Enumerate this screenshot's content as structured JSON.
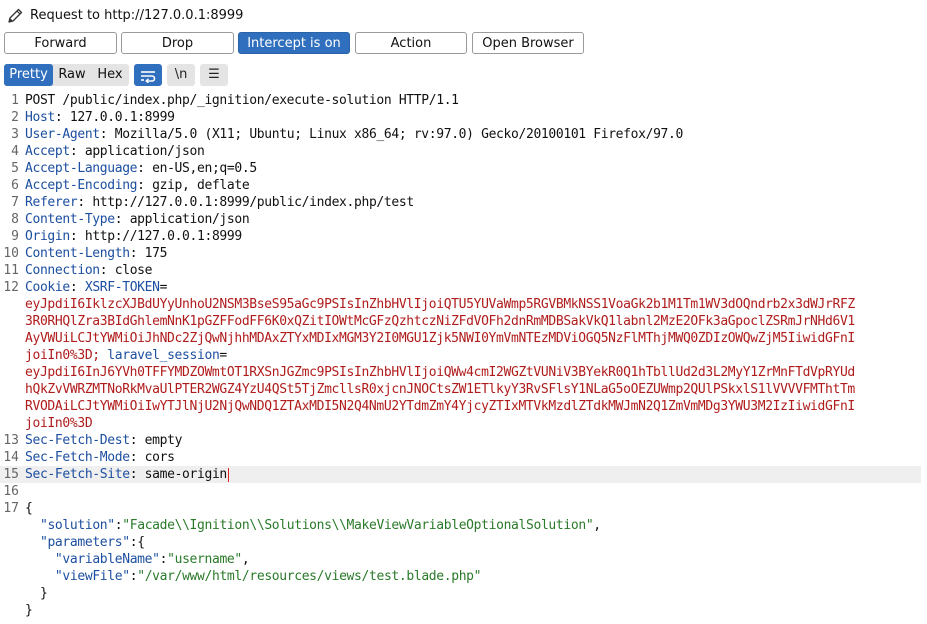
{
  "window": {
    "title": "Request to http://127.0.0.1:8999",
    "icon": "pencil-icon"
  },
  "actions": [
    {
      "id": "forward",
      "label": "Forward",
      "active": false
    },
    {
      "id": "drop",
      "label": "Drop",
      "active": false
    },
    {
      "id": "intercept",
      "label": "Intercept is on",
      "active": true
    },
    {
      "id": "action",
      "label": "Action",
      "active": false
    },
    {
      "id": "open-browser",
      "label": "Open Browser",
      "active": false
    }
  ],
  "view_tabs": [
    {
      "label": "Pretty",
      "active": true
    },
    {
      "label": "Raw",
      "active": false
    },
    {
      "label": "Hex",
      "active": false
    }
  ],
  "tools": [
    {
      "name": "wrap-lines-icon",
      "glyph": "⇆",
      "active": true
    },
    {
      "name": "newline-toggle-icon",
      "glyph": "\\n",
      "active": false
    },
    {
      "name": "menu-icon",
      "glyph": "☰",
      "active": false
    }
  ],
  "colors": {
    "accent": "#2f6fbd",
    "header_name": "#1d4fa0",
    "cookie_value": "#b01c1c",
    "json_string": "#2a7a2a"
  },
  "request": {
    "request_line": "POST /public/index.php/_ignition/execute-solution HTTP/1.1",
    "headers": [
      {
        "n": 2,
        "name": "Host",
        "value": "127.0.0.1:8999"
      },
      {
        "n": 3,
        "name": "User-Agent",
        "value": "Mozilla/5.0 (X11; Ubuntu; Linux x86_64; rv:97.0) Gecko/20100101 Firefox/97.0"
      },
      {
        "n": 4,
        "name": "Accept",
        "value": "application/json"
      },
      {
        "n": 5,
        "name": "Accept-Language",
        "value": "en-US,en;q=0.5"
      },
      {
        "n": 6,
        "name": "Accept-Encoding",
        "value": "gzip, deflate"
      },
      {
        "n": 7,
        "name": "Referer",
        "value": "http://127.0.0.1:8999/public/index.php/test"
      },
      {
        "n": 8,
        "name": "Content-Type",
        "value": "application/json"
      },
      {
        "n": 9,
        "name": "Origin",
        "value": "http://127.0.0.1:8999"
      },
      {
        "n": 10,
        "name": "Content-Length",
        "value": "175"
      },
      {
        "n": 11,
        "name": "Connection",
        "value": "close"
      }
    ],
    "cookie": {
      "name": "Cookie",
      "xsrf_name": "XSRF-TOKEN",
      "xsrf_lines": [
        "eyJpdiI6IklzcXJBdUYyUnhoU2NSM3BseS95aGc9PSIsInZhbHVlIjoiQTU5YUVaWmp5RGVBMkNSS1VoaGk2b1M1Tm1WV3dOQndrb2x3dWJrRFZ",
        "3R0RHQlZra3BIdGhlemNnK1pGZFFodFF6K0xQZitIOWtMcGFzQzhtczNiZFdVOFh2dnRmMDBSakVkQ1labnl2MzE2OFk3aGpoclZSRmJrNHd6V1",
        "AyVWUiLCJtYWMiOiJhNDc2ZjQwNjhhMDAxZTYxMDIxMGM3Y2I0MGU1Zjk5NWI0YmVmNTEzMDViOGQ5NzFlMThjMWQ0ZDIzOWQwZjM5IiwidGFnI",
        "joiIn0%3D;"
      ],
      "session_name": "laravel_session",
      "session_lines": [
        "eyJpdiI6InJ6YVh0TFFYMDZOWmtOT1RXSnJGZmc9PSIsInZhbHVlIjoiQWw4cmI2WGZtVUNiV3BYekR0Q1hTbllUd2d3L2MyY1ZrMnFTdVpRYUd",
        "hQkZvVWRZMTNoRkMvaUlPTER2WGZ4YzU4QSt5TjZmcllsR0xjcnJNOCtsZW1ETlkyY3RvSFlsY1NLaG5oOEZUWmp2QUlPSkxlS1lVVVVFMThtTm",
        "RVODAiLCJtYWMiOiIwYTJlNjU2NjQwNDQ1ZTAxMDI5N2Q4NmU2YTdmZmY4YjcyZTIxMTVkMzdlZTdkMWJmN2Q1ZmVmMDg3YWU3M2IzIiwidGFnI",
        "joiIn0%3D"
      ]
    },
    "tail_headers": [
      {
        "n": 13,
        "name": "Sec-Fetch-Dest",
        "value": "empty"
      },
      {
        "n": 14,
        "name": "Sec-Fetch-Mode",
        "value": "cors"
      },
      {
        "n": 15,
        "name": "Sec-Fetch-Site",
        "value": "same-origin"
      }
    ],
    "body": {
      "solution_key": "solution",
      "solution_value": "Facade\\\\Ignition\\\\Solutions\\\\MakeViewVariableOptionalSolution",
      "parameters_key": "parameters",
      "variable_name_key": "variableName",
      "variable_name_value": "username",
      "view_file_key": "viewFile",
      "view_file_value": "/var/www/html/resources/views/test.blade.php"
    }
  }
}
